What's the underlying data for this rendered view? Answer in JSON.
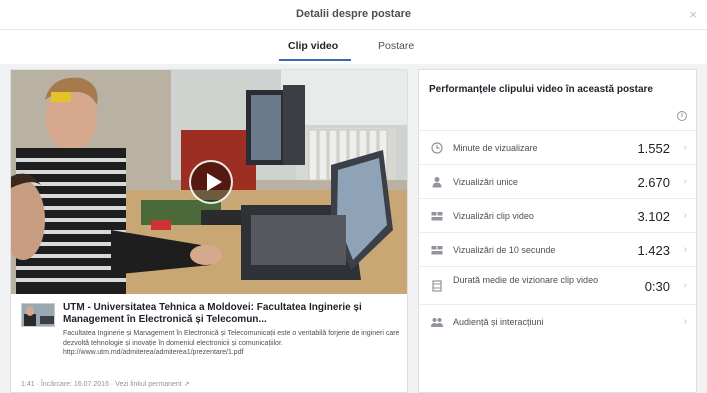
{
  "header": {
    "title": "Detalii despre postare",
    "close": "×"
  },
  "tabs": [
    {
      "label": "Clip video"
    },
    {
      "label": "Postare"
    }
  ],
  "post": {
    "title": "UTM - Universitatea Tehnica a Moldovei: Facultatea Inginerie și Management în Electronică și Telecomun...",
    "description": "Facultatea Inginerie și Management în Electronică și Telecomunicații este o veritabilă forjerie de ingineri care dezvoltă tehnologie și inovație în domeniul electronicii și comunicațiilor. http://www.utm.md/admiterea/admiterea1/prezentare/1.pdf",
    "duration": "1:41",
    "published": "Încărcare: 16.07.2016",
    "permalink": "Vezi linkul permanent"
  },
  "performance": {
    "title": "Performanțele clipului video în această postare",
    "info": "i",
    "metrics": [
      {
        "icon": "clock-icon",
        "label": "Minute de vizualizare",
        "value": "1.552"
      },
      {
        "icon": "person-icon",
        "label": "Vizualizări unice",
        "value": "2.670"
      },
      {
        "icon": "video-views-icon",
        "label": "Vizualizări clip video",
        "value": "3.102"
      },
      {
        "icon": "video-views-10s-icon",
        "label": "Vizualizări de 10 secunde",
        "value": "1.423"
      },
      {
        "icon": "film-icon",
        "label": "Durată medie de vizionare clip video",
        "value": "0:30"
      },
      {
        "icon": "audience-icon",
        "label": "Audiență și interacțiuni",
        "value": ""
      }
    ],
    "chevron": "›"
  }
}
